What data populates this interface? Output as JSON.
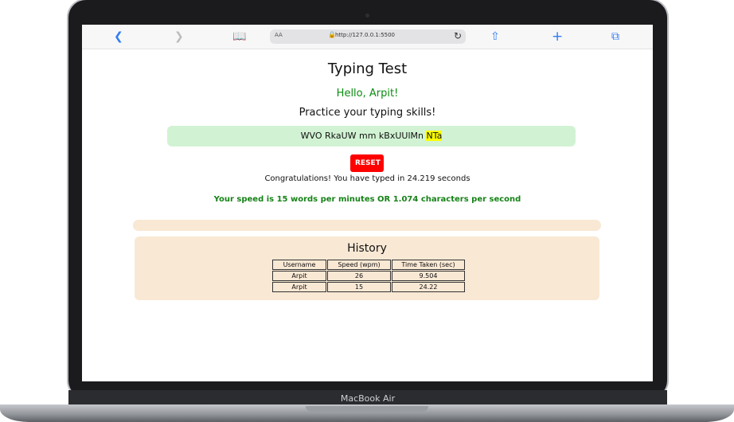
{
  "device": {
    "label": "MacBook Air"
  },
  "browser": {
    "address_prefix": "AA",
    "url": "http://127.0.0.1:5500"
  },
  "page": {
    "title": "Typing Test",
    "greeting": "Hello, Arpit!",
    "subtitle": "Practice your typing skills!",
    "sample_text": "WVO RkaUW mm kBxUUlMn",
    "sample_highlight": "NTa",
    "reset_label": "RESET",
    "result_message": "Congratulations! You have typed in 24.219 seconds",
    "speed_message": "Your speed is 15 words per minutes OR 1.074 characters per second"
  },
  "history": {
    "title": "History",
    "columns": [
      "Username",
      "Speed (wpm)",
      "Time Taken (sec)"
    ],
    "rows": [
      [
        "Arpit",
        "26",
        "9.504"
      ],
      [
        "Arpit",
        "15",
        "24.22"
      ]
    ]
  },
  "colors": {
    "greeting": "#0c8b12",
    "text_box_bg": "#d1f3d3",
    "reset_bg": "#ff0000",
    "history_bg": "#f9e8d4"
  }
}
